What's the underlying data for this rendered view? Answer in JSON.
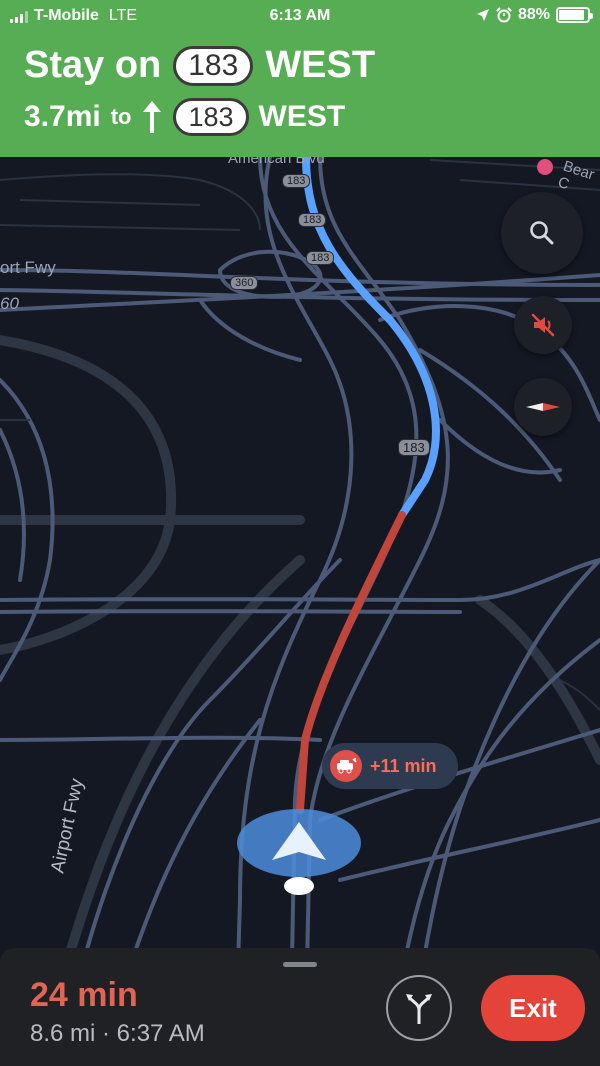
{
  "status_bar": {
    "carrier": "T-Mobile",
    "network": "LTE",
    "time": "6:13 AM",
    "battery": "88%",
    "battery_level": 0.88
  },
  "instruction": {
    "line1_prefix": "Stay on",
    "line1_route": "183",
    "line1_direction": "WEST",
    "distance": "3.7mi",
    "to": "to",
    "line2_route": "183",
    "line2_direction": "WEST"
  },
  "map": {
    "labels": {
      "american_blvd": "American Blvd",
      "airport_fwy_left": "ort Fwy",
      "number_60": "60",
      "bear": "Bear C",
      "airport_fwy": "Airport Fwy"
    },
    "shields": [
      "183",
      "183",
      "183",
      "360",
      "183"
    ],
    "traffic_delay": "+11 min",
    "colors": {
      "route_blue": "#5aa0ff",
      "route_red": "#c0453a",
      "road": "#4c5a78",
      "header_green": "#57ad54",
      "exit_red": "#e4433a"
    }
  },
  "bottom": {
    "eta_duration": "24 min",
    "eta_detail": "8.6 mi · 6:37 AM",
    "exit_label": "Exit"
  }
}
